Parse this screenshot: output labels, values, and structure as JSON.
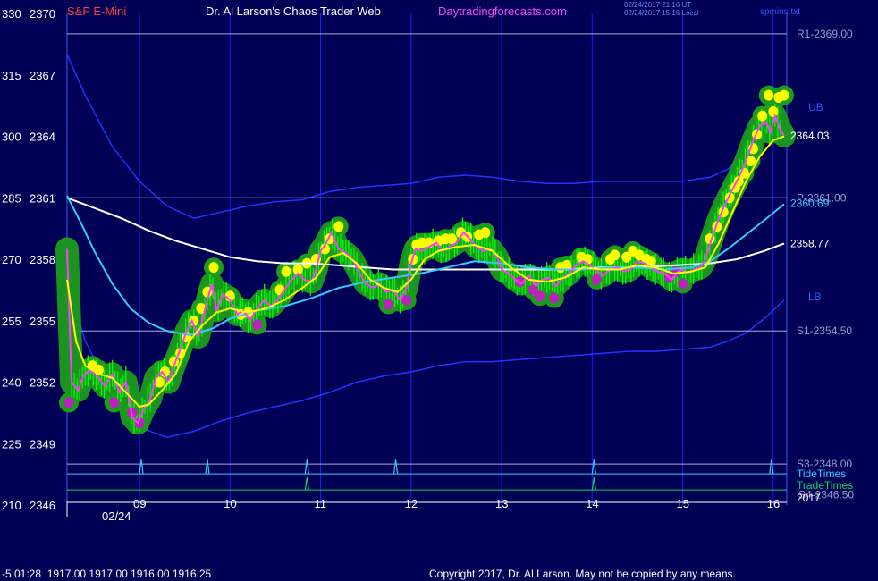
{
  "header": {
    "left_scale_label": "330",
    "price_label": "2370",
    "instrument": "S&P E-Mini",
    "title": "Dr. Al Larson's Chaos Trader Web",
    "site": "Daytradingforecasts.com",
    "timestamp_ut": "02/24/2017 21:16 UT",
    "timestamp_local": "02/24/2017 15:16 Local",
    "filename": "spmins.txt"
  },
  "footer": {
    "readout": "-5:01:28  1917.00 1917.00 1916.00 1916.25",
    "copyright": "Copyright 2017, Dr. Al Larson. May not be copied by any means."
  },
  "colors": {
    "background": "#000054",
    "price_line": "#ff3cff",
    "fast_ma": "#ffff00",
    "mid_ma": "#33ccff",
    "slow_ma": "#ffffff",
    "bands": "#2233ff",
    "volume_bars": "#00ff00",
    "glow": "#1b9c1b",
    "high_dot": "#ffff00",
    "low_dot": "#bb22bb",
    "level_line": "#aaaadd",
    "tide": "#33ccff",
    "trade": "#00dd55",
    "grid": "#1a1aff"
  },
  "chart_data": {
    "type": "line",
    "title": "S&P E-Mini",
    "x_ticks": [
      "09",
      "10",
      "11",
      "12",
      "13",
      "14",
      "15",
      "16"
    ],
    "date_label": "02/24",
    "y_ticks_left": [
      "330",
      "315",
      "300",
      "285",
      "270",
      "255",
      "240",
      "225",
      "210"
    ],
    "y_ticks_price": [
      "2370",
      "2367",
      "2364",
      "2361",
      "2358",
      "2355",
      "2352",
      "2349",
      "2346"
    ],
    "ylim": [
      2346,
      2370
    ],
    "xlim": [
      8.2,
      16.15
    ],
    "levels": [
      {
        "label": "R1-2369.00",
        "value": 2369.0
      },
      {
        "label": "P-2361.00",
        "value": 2361.0
      },
      {
        "label": "S1-2354.50",
        "value": 2354.5
      },
      {
        "label": "S3-2348.00",
        "value": 2348.0
      }
    ],
    "band_labels": {
      "upper": "UB",
      "lower": "LB"
    },
    "end_values": {
      "last": "2364.03",
      "mid_ma": "2360.69",
      "slow_ma": "2358.77"
    },
    "price": [
      [
        8.2,
        2358.5
      ],
      [
        8.25,
        2352.0
      ],
      [
        8.32,
        2351.6
      ],
      [
        8.38,
        2352.3
      ],
      [
        8.45,
        2352.6
      ],
      [
        8.55,
        2352.2
      ],
      [
        8.62,
        2351.8
      ],
      [
        8.7,
        2352.4
      ],
      [
        8.78,
        2351.5
      ],
      [
        8.85,
        2352.0
      ],
      [
        8.92,
        2350.3
      ],
      [
        8.98,
        2350.0
      ],
      [
        9.05,
        2350.7
      ],
      [
        9.12,
        2351.2
      ],
      [
        9.18,
        2352.2
      ],
      [
        9.25,
        2352.5
      ],
      [
        9.32,
        2352.0
      ],
      [
        9.38,
        2352.8
      ],
      [
        9.45,
        2353.6
      ],
      [
        9.52,
        2354.5
      ],
      [
        9.58,
        2355.0
      ],
      [
        9.65,
        2354.2
      ],
      [
        9.72,
        2355.5
      ],
      [
        9.8,
        2356.8
      ],
      [
        9.85,
        2355.5
      ],
      [
        9.92,
        2356.3
      ],
      [
        10.0,
        2356.0
      ],
      [
        10.08,
        2355.3
      ],
      [
        10.15,
        2355.5
      ],
      [
        10.22,
        2355.0
      ],
      [
        10.3,
        2355.6
      ],
      [
        10.38,
        2356.0
      ],
      [
        10.45,
        2355.7
      ],
      [
        10.52,
        2356.0
      ],
      [
        10.6,
        2356.5
      ],
      [
        10.68,
        2357.0
      ],
      [
        10.75,
        2357.3
      ],
      [
        10.82,
        2357.0
      ],
      [
        10.9,
        2356.9
      ],
      [
        10.95,
        2357.5
      ],
      [
        11.0,
        2358.4
      ],
      [
        11.05,
        2358.7
      ],
      [
        11.12,
        2359.3
      ],
      [
        11.2,
        2358.5
      ],
      [
        11.28,
        2358.3
      ],
      [
        11.35,
        2358.0
      ],
      [
        11.42,
        2357.4
      ],
      [
        11.5,
        2356.8
      ],
      [
        11.58,
        2356.6
      ],
      [
        11.65,
        2356.8
      ],
      [
        11.72,
        2356.4
      ],
      [
        11.8,
        2356.5
      ],
      [
        11.88,
        2356.0
      ],
      [
        11.95,
        2356.6
      ],
      [
        12.0,
        2357.8
      ],
      [
        12.05,
        2358.5
      ],
      [
        12.12,
        2358.4
      ],
      [
        12.2,
        2358.6
      ],
      [
        12.28,
        2358.8
      ],
      [
        12.35,
        2358.4
      ],
      [
        12.42,
        2358.6
      ],
      [
        12.5,
        2358.8
      ],
      [
        12.58,
        2359.3
      ],
      [
        12.65,
        2359.0
      ],
      [
        12.72,
        2358.6
      ],
      [
        12.8,
        2358.4
      ],
      [
        12.88,
        2358.5
      ],
      [
        12.95,
        2358.1
      ],
      [
        13.0,
        2357.5
      ],
      [
        13.08,
        2357.3
      ],
      [
        13.15,
        2357.0
      ],
      [
        13.22,
        2356.8
      ],
      [
        13.3,
        2357.2
      ],
      [
        13.38,
        2356.7
      ],
      [
        13.45,
        2357.0
      ],
      [
        13.52,
        2357.1
      ],
      [
        13.6,
        2356.7
      ],
      [
        13.68,
        2357.1
      ],
      [
        13.75,
        2357.3
      ],
      [
        13.82,
        2357.7
      ],
      [
        13.9,
        2357.9
      ],
      [
        13.98,
        2357.7
      ],
      [
        14.05,
        2357.4
      ],
      [
        14.12,
        2357.2
      ],
      [
        14.2,
        2357.5
      ],
      [
        14.28,
        2357.6
      ],
      [
        14.35,
        2357.4
      ],
      [
        14.42,
        2357.5
      ],
      [
        14.5,
        2357.9
      ],
      [
        14.58,
        2357.8
      ],
      [
        14.65,
        2357.6
      ],
      [
        14.72,
        2357.4
      ],
      [
        14.8,
        2357.3
      ],
      [
        14.88,
        2357.0
      ],
      [
        14.95,
        2357.4
      ],
      [
        15.0,
        2357.5
      ],
      [
        15.05,
        2357.3
      ],
      [
        15.12,
        2357.5
      ],
      [
        15.2,
        2357.6
      ],
      [
        15.25,
        2358.0
      ],
      [
        15.32,
        2359.0
      ],
      [
        15.4,
        2360.0
      ],
      [
        15.48,
        2360.8
      ],
      [
        15.55,
        2361.4
      ],
      [
        15.62,
        2362.0
      ],
      [
        15.7,
        2362.8
      ],
      [
        15.78,
        2363.8
      ],
      [
        15.85,
        2364.5
      ],
      [
        15.92,
        2364.7
      ],
      [
        15.97,
        2364.2
      ],
      [
        16.02,
        2365.0
      ],
      [
        16.08,
        2364.3
      ],
      [
        16.12,
        2364.03
      ]
    ],
    "fast_ma": [
      [
        8.2,
        2357.0
      ],
      [
        8.3,
        2354.0
      ],
      [
        8.4,
        2352.8
      ],
      [
        8.55,
        2352.4
      ],
      [
        8.7,
        2352.2
      ],
      [
        8.85,
        2351.5
      ],
      [
        9.0,
        2350.8
      ],
      [
        9.1,
        2350.9
      ],
      [
        9.25,
        2351.6
      ],
      [
        9.4,
        2352.4
      ],
      [
        9.55,
        2354.0
      ],
      [
        9.7,
        2354.8
      ],
      [
        9.85,
        2355.4
      ],
      [
        10.0,
        2355.6
      ],
      [
        10.2,
        2355.4
      ],
      [
        10.4,
        2355.6
      ],
      [
        10.6,
        2356.0
      ],
      [
        10.8,
        2356.6
      ],
      [
        10.95,
        2357.1
      ],
      [
        11.1,
        2358.1
      ],
      [
        11.25,
        2358.3
      ],
      [
        11.4,
        2357.8
      ],
      [
        11.55,
        2357.0
      ],
      [
        11.7,
        2356.6
      ],
      [
        11.85,
        2356.4
      ],
      [
        12.0,
        2357.0
      ],
      [
        12.15,
        2358.0
      ],
      [
        12.3,
        2358.4
      ],
      [
        12.5,
        2358.6
      ],
      [
        12.7,
        2358.7
      ],
      [
        12.9,
        2358.4
      ],
      [
        13.1,
        2357.6
      ],
      [
        13.3,
        2357.0
      ],
      [
        13.5,
        2356.9
      ],
      [
        13.7,
        2357.1
      ],
      [
        13.9,
        2357.6
      ],
      [
        14.1,
        2357.5
      ],
      [
        14.3,
        2357.5
      ],
      [
        14.5,
        2357.7
      ],
      [
        14.7,
        2357.6
      ],
      [
        14.9,
        2357.3
      ],
      [
        15.1,
        2357.4
      ],
      [
        15.25,
        2357.6
      ],
      [
        15.4,
        2358.8
      ],
      [
        15.55,
        2360.3
      ],
      [
        15.7,
        2361.8
      ],
      [
        15.85,
        2363.0
      ],
      [
        16.0,
        2363.8
      ],
      [
        16.12,
        2364.0
      ]
    ],
    "mid_ma": [
      [
        8.2,
        2361.1
      ],
      [
        8.35,
        2359.8
      ],
      [
        8.5,
        2358.4
      ],
      [
        8.7,
        2356.8
      ],
      [
        8.9,
        2355.6
      ],
      [
        9.1,
        2354.9
      ],
      [
        9.3,
        2354.5
      ],
      [
        9.55,
        2354.3
      ],
      [
        9.8,
        2354.6
      ],
      [
        10.0,
        2355.1
      ],
      [
        10.3,
        2355.5
      ],
      [
        10.6,
        2355.7
      ],
      [
        10.9,
        2356.1
      ],
      [
        11.2,
        2356.6
      ],
      [
        11.5,
        2356.9
      ],
      [
        11.8,
        2357.1
      ],
      [
        12.1,
        2357.3
      ],
      [
        12.4,
        2357.6
      ],
      [
        12.7,
        2357.9
      ],
      [
        13.0,
        2357.8
      ],
      [
        13.3,
        2357.6
      ],
      [
        13.6,
        2357.5
      ],
      [
        13.9,
        2357.5
      ],
      [
        14.2,
        2357.6
      ],
      [
        14.5,
        2357.6
      ],
      [
        14.8,
        2357.5
      ],
      [
        15.1,
        2357.6
      ],
      [
        15.3,
        2357.9
      ],
      [
        15.5,
        2358.5
      ],
      [
        15.7,
        2359.2
      ],
      [
        15.9,
        2359.9
      ],
      [
        16.12,
        2360.69
      ]
    ],
    "slow_ma": [
      [
        8.2,
        2361.0
      ],
      [
        8.5,
        2360.5
      ],
      [
        8.8,
        2360.0
      ],
      [
        9.1,
        2359.4
      ],
      [
        9.4,
        2358.9
      ],
      [
        9.7,
        2358.5
      ],
      [
        10.0,
        2358.1
      ],
      [
        10.3,
        2357.9
      ],
      [
        10.6,
        2357.8
      ],
      [
        10.9,
        2357.8
      ],
      [
        11.2,
        2357.7
      ],
      [
        11.5,
        2357.6
      ],
      [
        11.8,
        2357.5
      ],
      [
        12.1,
        2357.5
      ],
      [
        12.5,
        2357.5
      ],
      [
        12.9,
        2357.5
      ],
      [
        13.3,
        2357.5
      ],
      [
        13.7,
        2357.5
      ],
      [
        14.1,
        2357.6
      ],
      [
        14.5,
        2357.6
      ],
      [
        14.9,
        2357.7
      ],
      [
        15.3,
        2357.8
      ],
      [
        15.6,
        2358.0
      ],
      [
        15.9,
        2358.4
      ],
      [
        16.12,
        2358.77
      ]
    ],
    "upper_band": [
      [
        8.2,
        2368.0
      ],
      [
        8.4,
        2366.0
      ],
      [
        8.7,
        2363.5
      ],
      [
        9.0,
        2361.8
      ],
      [
        9.3,
        2360.6
      ],
      [
        9.6,
        2360.0
      ],
      [
        9.9,
        2360.3
      ],
      [
        10.2,
        2360.6
      ],
      [
        10.5,
        2360.8
      ],
      [
        10.8,
        2360.9
      ],
      [
        11.1,
        2361.3
      ],
      [
        11.4,
        2361.5
      ],
      [
        11.7,
        2361.6
      ],
      [
        12.0,
        2361.7
      ],
      [
        12.3,
        2362.0
      ],
      [
        12.6,
        2362.1
      ],
      [
        12.9,
        2362.0
      ],
      [
        13.2,
        2361.8
      ],
      [
        13.5,
        2361.7
      ],
      [
        13.8,
        2361.7
      ],
      [
        14.1,
        2361.8
      ],
      [
        14.4,
        2361.8
      ],
      [
        14.7,
        2361.8
      ],
      [
        15.0,
        2361.8
      ],
      [
        15.3,
        2362.0
      ],
      [
        15.5,
        2362.4
      ],
      [
        15.7,
        2363.2
      ],
      [
        15.9,
        2364.5
      ],
      [
        16.12,
        2366.5
      ]
    ],
    "lower_band": [
      [
        8.2,
        2357.0
      ],
      [
        8.4,
        2354.0
      ],
      [
        8.7,
        2351.5
      ],
      [
        9.0,
        2349.8
      ],
      [
        9.3,
        2349.3
      ],
      [
        9.6,
        2349.6
      ],
      [
        9.9,
        2350.1
      ],
      [
        10.2,
        2350.5
      ],
      [
        10.5,
        2350.8
      ],
      [
        10.8,
        2351.1
      ],
      [
        11.1,
        2351.5
      ],
      [
        11.4,
        2352.0
      ],
      [
        11.7,
        2352.3
      ],
      [
        12.0,
        2352.5
      ],
      [
        12.3,
        2352.8
      ],
      [
        12.6,
        2353.0
      ],
      [
        12.9,
        2353.0
      ],
      [
        13.2,
        2353.1
      ],
      [
        13.5,
        2353.2
      ],
      [
        13.8,
        2353.3
      ],
      [
        14.1,
        2353.4
      ],
      [
        14.4,
        2353.5
      ],
      [
        14.7,
        2353.5
      ],
      [
        15.0,
        2353.6
      ],
      [
        15.3,
        2353.7
      ],
      [
        15.5,
        2354.0
      ],
      [
        15.7,
        2354.4
      ],
      [
        15.9,
        2355.1
      ],
      [
        16.12,
        2356.0
      ]
    ],
    "highs": [
      [
        8.48,
        2352.8
      ],
      [
        8.55,
        2352.6
      ],
      [
        9.22,
        2352.0
      ],
      [
        9.28,
        2352.5
      ],
      [
        9.38,
        2353.0
      ],
      [
        9.45,
        2353.4
      ],
      [
        9.52,
        2354.2
      ],
      [
        9.6,
        2355.0
      ],
      [
        9.68,
        2355.6
      ],
      [
        9.75,
        2356.4
      ],
      [
        9.82,
        2357.6
      ],
      [
        10.0,
        2356.2
      ],
      [
        10.12,
        2355.3
      ],
      [
        10.2,
        2355.4
      ],
      [
        10.55,
        2356.5
      ],
      [
        10.62,
        2357.4
      ],
      [
        10.75,
        2357.5
      ],
      [
        10.85,
        2357.8
      ],
      [
        10.95,
        2358.0
      ],
      [
        11.05,
        2358.5
      ],
      [
        11.1,
        2359.0
      ],
      [
        11.2,
        2359.6
      ],
      [
        12.02,
        2358.0
      ],
      [
        12.06,
        2358.7
      ],
      [
        12.12,
        2358.8
      ],
      [
        12.2,
        2358.8
      ],
      [
        12.3,
        2358.9
      ],
      [
        12.38,
        2359.0
      ],
      [
        12.45,
        2359.0
      ],
      [
        12.55,
        2359.3
      ],
      [
        12.62,
        2359.1
      ],
      [
        12.75,
        2359.2
      ],
      [
        12.82,
        2359.3
      ],
      [
        13.65,
        2357.6
      ],
      [
        13.72,
        2357.7
      ],
      [
        13.88,
        2358.1
      ],
      [
        13.95,
        2358.0
      ],
      [
        14.2,
        2358.0
      ],
      [
        14.25,
        2358.2
      ],
      [
        14.38,
        2358.1
      ],
      [
        14.45,
        2358.4
      ],
      [
        14.52,
        2358.2
      ],
      [
        14.6,
        2358.0
      ],
      [
        14.65,
        2357.9
      ],
      [
        15.3,
        2359.0
      ],
      [
        15.38,
        2359.6
      ],
      [
        15.45,
        2360.3
      ],
      [
        15.52,
        2361.0
      ],
      [
        15.58,
        2361.5
      ],
      [
        15.62,
        2361.8
      ],
      [
        15.68,
        2362.2
      ],
      [
        15.75,
        2362.8
      ],
      [
        15.78,
        2363.4
      ],
      [
        15.82,
        2364.1
      ],
      [
        15.88,
        2365.0
      ],
      [
        15.95,
        2366.0
      ],
      [
        16.0,
        2365.2
      ],
      [
        16.06,
        2365.9
      ],
      [
        16.12,
        2366.0
      ]
    ],
    "lows": [
      [
        8.22,
        2351.0
      ],
      [
        8.72,
        2351.0
      ],
      [
        8.92,
        2350.5
      ],
      [
        9.0,
        2350.0
      ],
      [
        10.3,
        2354.8
      ],
      [
        11.75,
        2355.8
      ],
      [
        11.95,
        2356.0
      ],
      [
        13.2,
        2356.9
      ],
      [
        13.35,
        2356.5
      ],
      [
        13.42,
        2356.2
      ],
      [
        13.58,
        2356.1
      ],
      [
        14.05,
        2357.0
      ],
      [
        14.85,
        2357.1
      ],
      [
        14.92,
        2357.4
      ],
      [
        15.0,
        2356.8
      ]
    ],
    "tide_times": [
      9.02,
      9.75,
      10.85,
      11.83,
      14.02,
      15.98
    ],
    "trade_times": [
      10.85,
      14.02
    ],
    "marker_labels": {
      "tide": "TideTimes",
      "trade": "TradeTimes",
      "year": "2017",
      "s4": "S4-2346.50"
    }
  }
}
